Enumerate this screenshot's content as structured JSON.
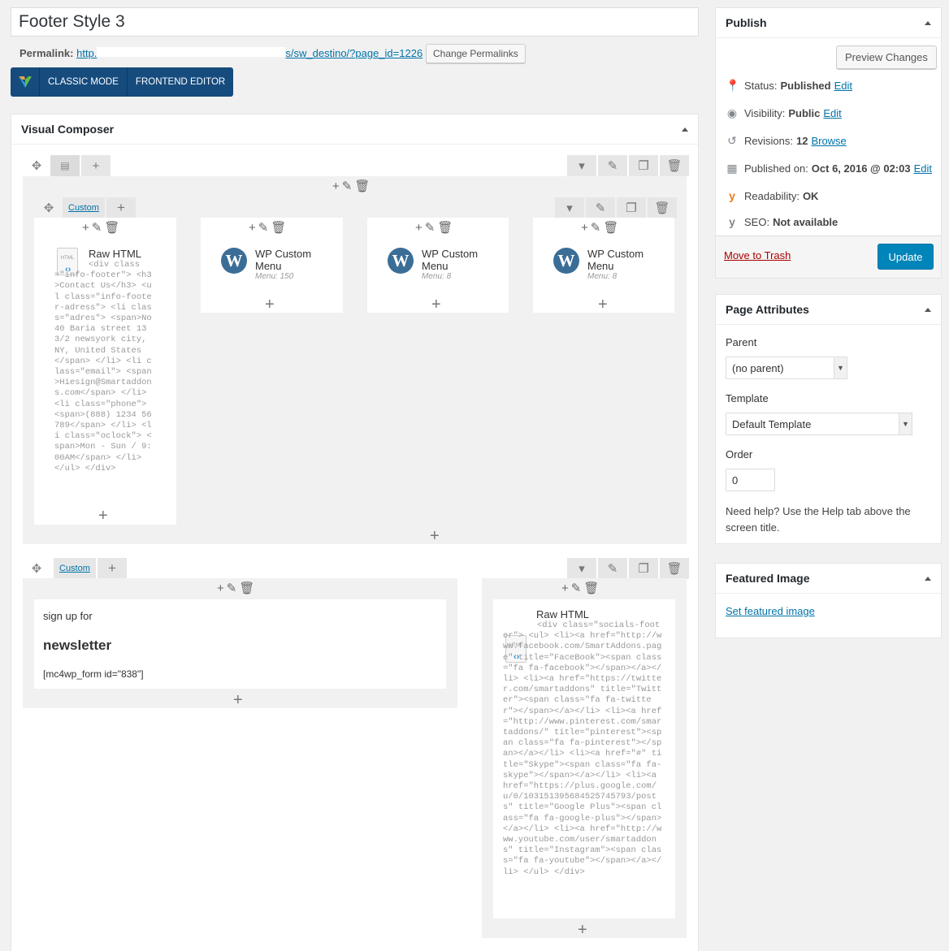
{
  "post_title": "Footer Style 3",
  "permalink": {
    "label": "Permalink:",
    "prefix": "http.",
    "suffix": "s/sw_destino/?page_id=1226",
    "button": "Change Permalinks"
  },
  "vc_bar": {
    "classic": "CLASSIC MODE",
    "frontend": "FRONTEND EDITOR"
  },
  "composer": {
    "title": "Visual Composer",
    "row1": {
      "inner_tab": "Custom",
      "col1": {
        "title": "Raw HTML",
        "code": "<div class=\"info-footer\"> <h3>Contact Us</h3> <ul class=\"info-footer-adress\"> <li class=\"adres\"> <span>No 40 Baria street 133/2 newsyork city, NY, United States </span> </li> <li class=\"email\"> <span>Hiesign@Smartaddons.com</span> </li> <li class=\"phone\"> <span>(888) 1234 56789</span> </li> <li class=\"oclock\"> <span>Mon - Sun / 9:00AM</span> </li> </ul> </div>"
      },
      "col2": {
        "title": "WP Custom Menu",
        "menu": "Menu: 150"
      },
      "col3": {
        "title": "WP Custom Menu",
        "menu": "Menu: 8"
      },
      "col4": {
        "title": "WP Custom Menu",
        "menu": "Menu: 8"
      }
    },
    "row2": {
      "tab": "Custom",
      "text_small": "sign up for",
      "text_heading": "newsletter",
      "shortcode": "[mc4wp_form id=\"838\"]",
      "raw_title": "Raw HTML",
      "raw_code": "<div class=\"socials-footer\"> <ul> <li><a href=\"http://www.facebook.com/SmartAddons.page\" title=\"FaceBook\"><span class=\"fa fa-facebook\"></span></a></li> <li><a href=\"https://twitter.com/smartaddons\" title=\"Twitter\"><span class=\"fa fa-twitter\"></span></a></li> <li><a href=\"http://www.pinterest.com/smartaddons/\" title=\"pinterest\"><span class=\"fa fa-pinterest\"></span></a></li> <li><a href=\"#\" title=\"Skype\"><span class=\"fa fa-skype\"></span></a></li> <li><a href=\"https://plus.google.com/u/0/103151395684525745793/posts\" title=\"Google Plus\"><span class=\"fa fa-google-plus\"></span></a></li> <li><a href=\"http://www.youtube.com/user/smartaddons\" title=\"Instagram\"><span class=\"fa fa-youtube\"></span></a></li> </ul> </div>"
    }
  },
  "publish": {
    "title": "Publish",
    "preview": "Preview Changes",
    "status_label": "Status:",
    "status_value": "Published",
    "status_edit": "Edit",
    "visibility_label": "Visibility:",
    "visibility_value": "Public",
    "visibility_edit": "Edit",
    "revisions_label": "Revisions:",
    "revisions_value": "12",
    "revisions_link": "Browse",
    "published_label": "Published on:",
    "published_value": "Oct 6, 2016 @ 02:03",
    "published_edit": "Edit",
    "readability_label": "Readability:",
    "readability_value": "OK",
    "seo_label": "SEO:",
    "seo_value": "Not available",
    "trash": "Move to Trash",
    "update": "Update"
  },
  "page_attributes": {
    "title": "Page Attributes",
    "parent_label": "Parent",
    "parent_value": "(no parent)",
    "template_label": "Template",
    "template_value": "Default Template",
    "order_label": "Order",
    "order_value": "0",
    "help": "Need help? Use the Help tab above the screen title."
  },
  "featured_image": {
    "title": "Featured Image",
    "link": "Set featured image"
  },
  "colors": {
    "primary": "#0085ba",
    "vc_bar": "#164b7d",
    "link": "#0073aa"
  }
}
